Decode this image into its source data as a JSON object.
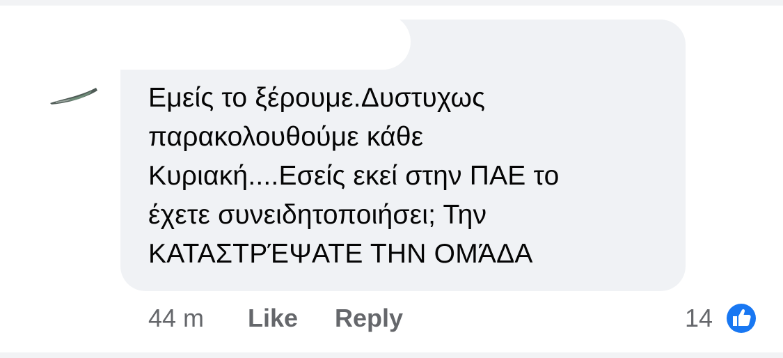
{
  "comment": {
    "text": "Εμείς το ξέρουμε.Δυστυχως\nπαρακολουθούμε κάθε\nΚυριακή....Εσείς εκεί στην ΠΑΕ το\nέχετε συνειδητοποιήσει; Την\nΚΑΤΑΣΤΡΈΨΑΤΕ ΤΗΝ ΟΜΆΔΑ"
  },
  "meta": {
    "timestamp": "44 m",
    "like_label": "Like",
    "reply_label": "Reply"
  },
  "reactions": {
    "count": "14",
    "icon": "thumbs-up-icon",
    "color": "#1877f2"
  },
  "colors": {
    "bubble": "#f0f2f5",
    "text": "#050505",
    "secondary_text": "#65676b"
  }
}
